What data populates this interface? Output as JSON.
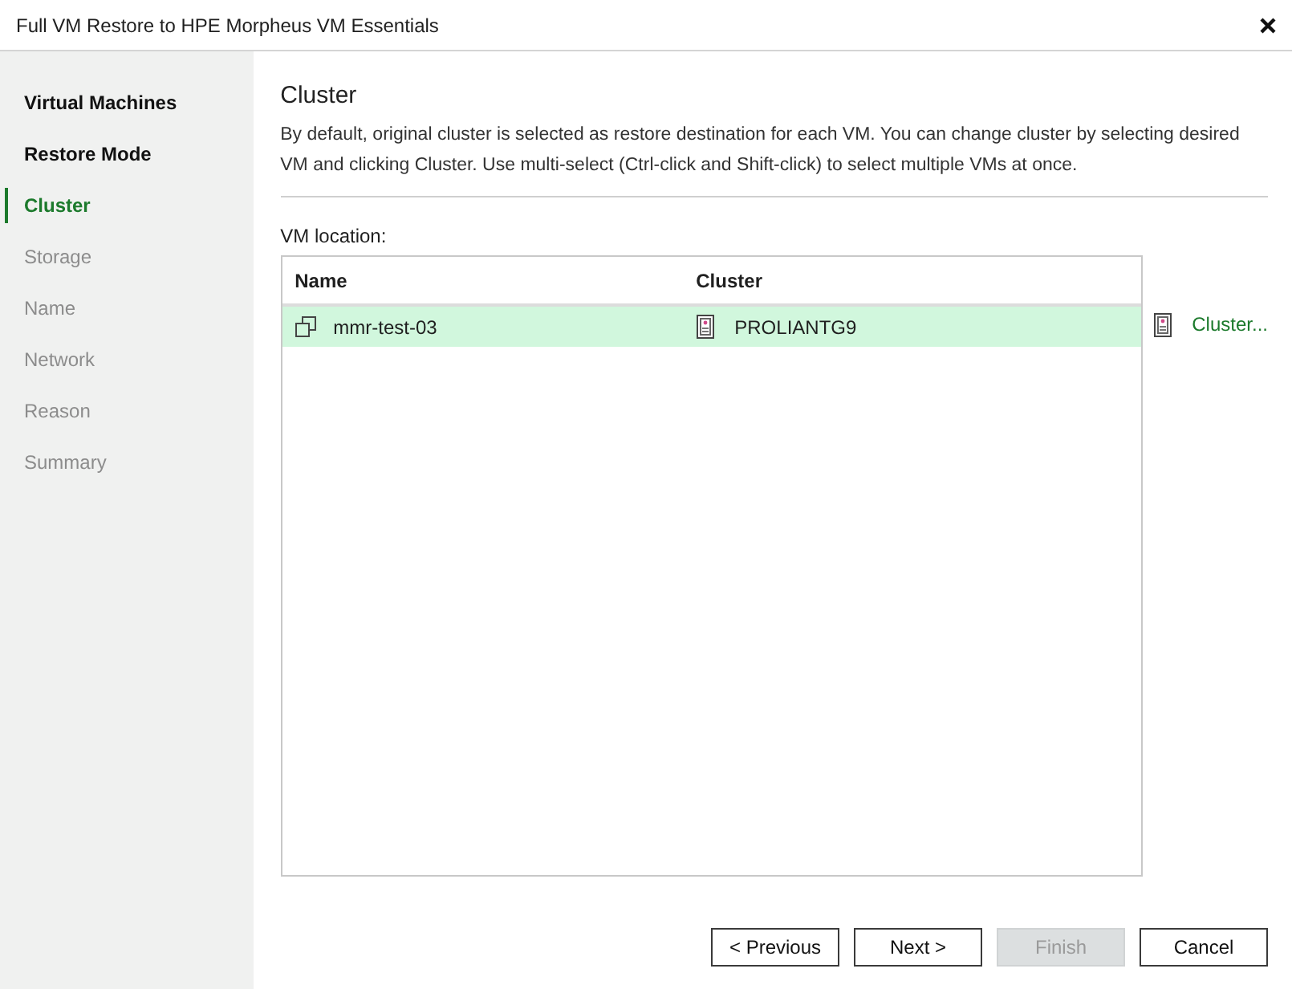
{
  "window": {
    "title": "Full VM Restore to HPE Morpheus VM Essentials"
  },
  "steps": [
    {
      "label": "Virtual Machines",
      "selected": false,
      "disabled": false
    },
    {
      "label": "Restore Mode",
      "selected": false,
      "disabled": false
    },
    {
      "label": "Cluster",
      "selected": true,
      "disabled": false
    },
    {
      "label": "Storage",
      "selected": false,
      "disabled": true
    },
    {
      "label": "Name",
      "selected": false,
      "disabled": true
    },
    {
      "label": "Network",
      "selected": false,
      "disabled": true
    },
    {
      "label": "Reason",
      "selected": false,
      "disabled": true
    },
    {
      "label": "Summary",
      "selected": false,
      "disabled": true
    }
  ],
  "page": {
    "heading": "Cluster",
    "description": "By default, original cluster is selected as restore destination for each VM. You can change cluster by selecting desired VM and clicking Cluster. Use multi-select (Ctrl-click and Shift-click) to select multiple VMs at once.",
    "list_label": "VM location:"
  },
  "table": {
    "columns": [
      "Name",
      "Cluster"
    ],
    "rows": [
      {
        "name": "mmr-test-03",
        "cluster": "PROLIANTG9",
        "selected": true
      }
    ]
  },
  "cluster_button": {
    "label": "Cluster..."
  },
  "buttons": [
    {
      "label": "< Previous",
      "disabled": false
    },
    {
      "label": "Next >",
      "disabled": false
    },
    {
      "label": "Finish",
      "disabled": true
    },
    {
      "label": "Cancel",
      "disabled": false
    }
  ]
}
